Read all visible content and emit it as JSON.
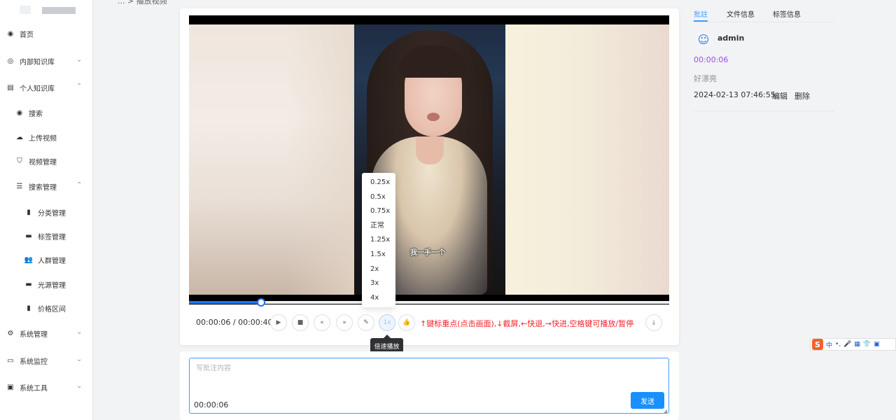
{
  "breadcrumb": "... > 播放视频",
  "sidebar": {
    "items": [
      {
        "label": "首页",
        "icon": "dashboard-icon",
        "glyph": "◉",
        "chevron": ""
      },
      {
        "label": "内部知识库",
        "icon": "github-icon",
        "glyph": "◎",
        "chevron": "⌄"
      },
      {
        "label": "个人知识库",
        "icon": "document-icon",
        "glyph": "▤",
        "chevron": "⌃"
      },
      {
        "label": "搜索",
        "icon": "radio-icon",
        "glyph": "◉",
        "chevron": ""
      },
      {
        "label": "上传视频",
        "icon": "upload-icon",
        "glyph": "☁",
        "chevron": ""
      },
      {
        "label": "视频管理",
        "icon": "shield-icon",
        "glyph": "⛉",
        "chevron": ""
      },
      {
        "label": "搜索管理",
        "icon": "list-icon",
        "glyph": "☰",
        "chevron": "⌃"
      },
      {
        "label": "分类管理",
        "icon": "tag-icon",
        "glyph": "▮",
        "chevron": ""
      },
      {
        "label": "标签管理",
        "icon": "label-icon",
        "glyph": "▬",
        "chevron": ""
      },
      {
        "label": "人群管理",
        "icon": "people-icon",
        "glyph": "👥",
        "chevron": ""
      },
      {
        "label": "光源管理",
        "icon": "light-icon",
        "glyph": "▬",
        "chevron": ""
      },
      {
        "label": "价格区间",
        "icon": "bar-chart-icon",
        "glyph": "▮",
        "chevron": ""
      },
      {
        "label": "系统管理",
        "icon": "gear-icon",
        "glyph": "⚙",
        "chevron": "⌄"
      },
      {
        "label": "系统监控",
        "icon": "monitor-icon",
        "glyph": "▭",
        "chevron": "⌄"
      },
      {
        "label": "系统工具",
        "icon": "toolbox-icon",
        "glyph": "▣",
        "chevron": "⌄"
      }
    ]
  },
  "player": {
    "subtitle": "我一手一个",
    "time_display": "00:00:06 / 00:00:40",
    "progress": 0.15,
    "hint": "↑键标重点(点击画面),↓截屏,←快退,→快进,空格键可播放/暂停",
    "speed_options": [
      "0.25x",
      "0.5x",
      "0.75x",
      "正常",
      "1.25x",
      "1.5x",
      "2x",
      "3x",
      "4x"
    ],
    "speed_tooltip": "倍速播放",
    "controls": [
      {
        "name": "play-button",
        "glyph": "▶"
      },
      {
        "name": "stop-button",
        "glyph": "■"
      },
      {
        "name": "rewind-button",
        "glyph": "«"
      },
      {
        "name": "forward-button",
        "glyph": "»"
      },
      {
        "name": "edit-button",
        "glyph": "✎"
      },
      {
        "name": "speed-button",
        "glyph": "1x"
      },
      {
        "name": "like-button",
        "glyph": "👍"
      },
      {
        "name": "download-button",
        "glyph": "⤓"
      }
    ]
  },
  "comment_input": {
    "placeholder": "写批注内容",
    "timestamp": "00:00:06",
    "send_label": "发送"
  },
  "right_panel": {
    "tabs": [
      "批註",
      "文件信息",
      "标签信息"
    ],
    "user": "admin",
    "time": "00:00:06",
    "text": "好漂亮",
    "date": "2024-02-13 07:46:55",
    "edit_label": "编辑",
    "delete_label": "删除"
  },
  "ime": {
    "logo": "S",
    "items": [
      "中",
      "•,",
      "🎤",
      "▦",
      "👕",
      "▣"
    ]
  },
  "colors": {
    "accent": "#409eff",
    "hint": "#f5222d",
    "send": "#1890ff",
    "time_purple": "#9254de"
  }
}
